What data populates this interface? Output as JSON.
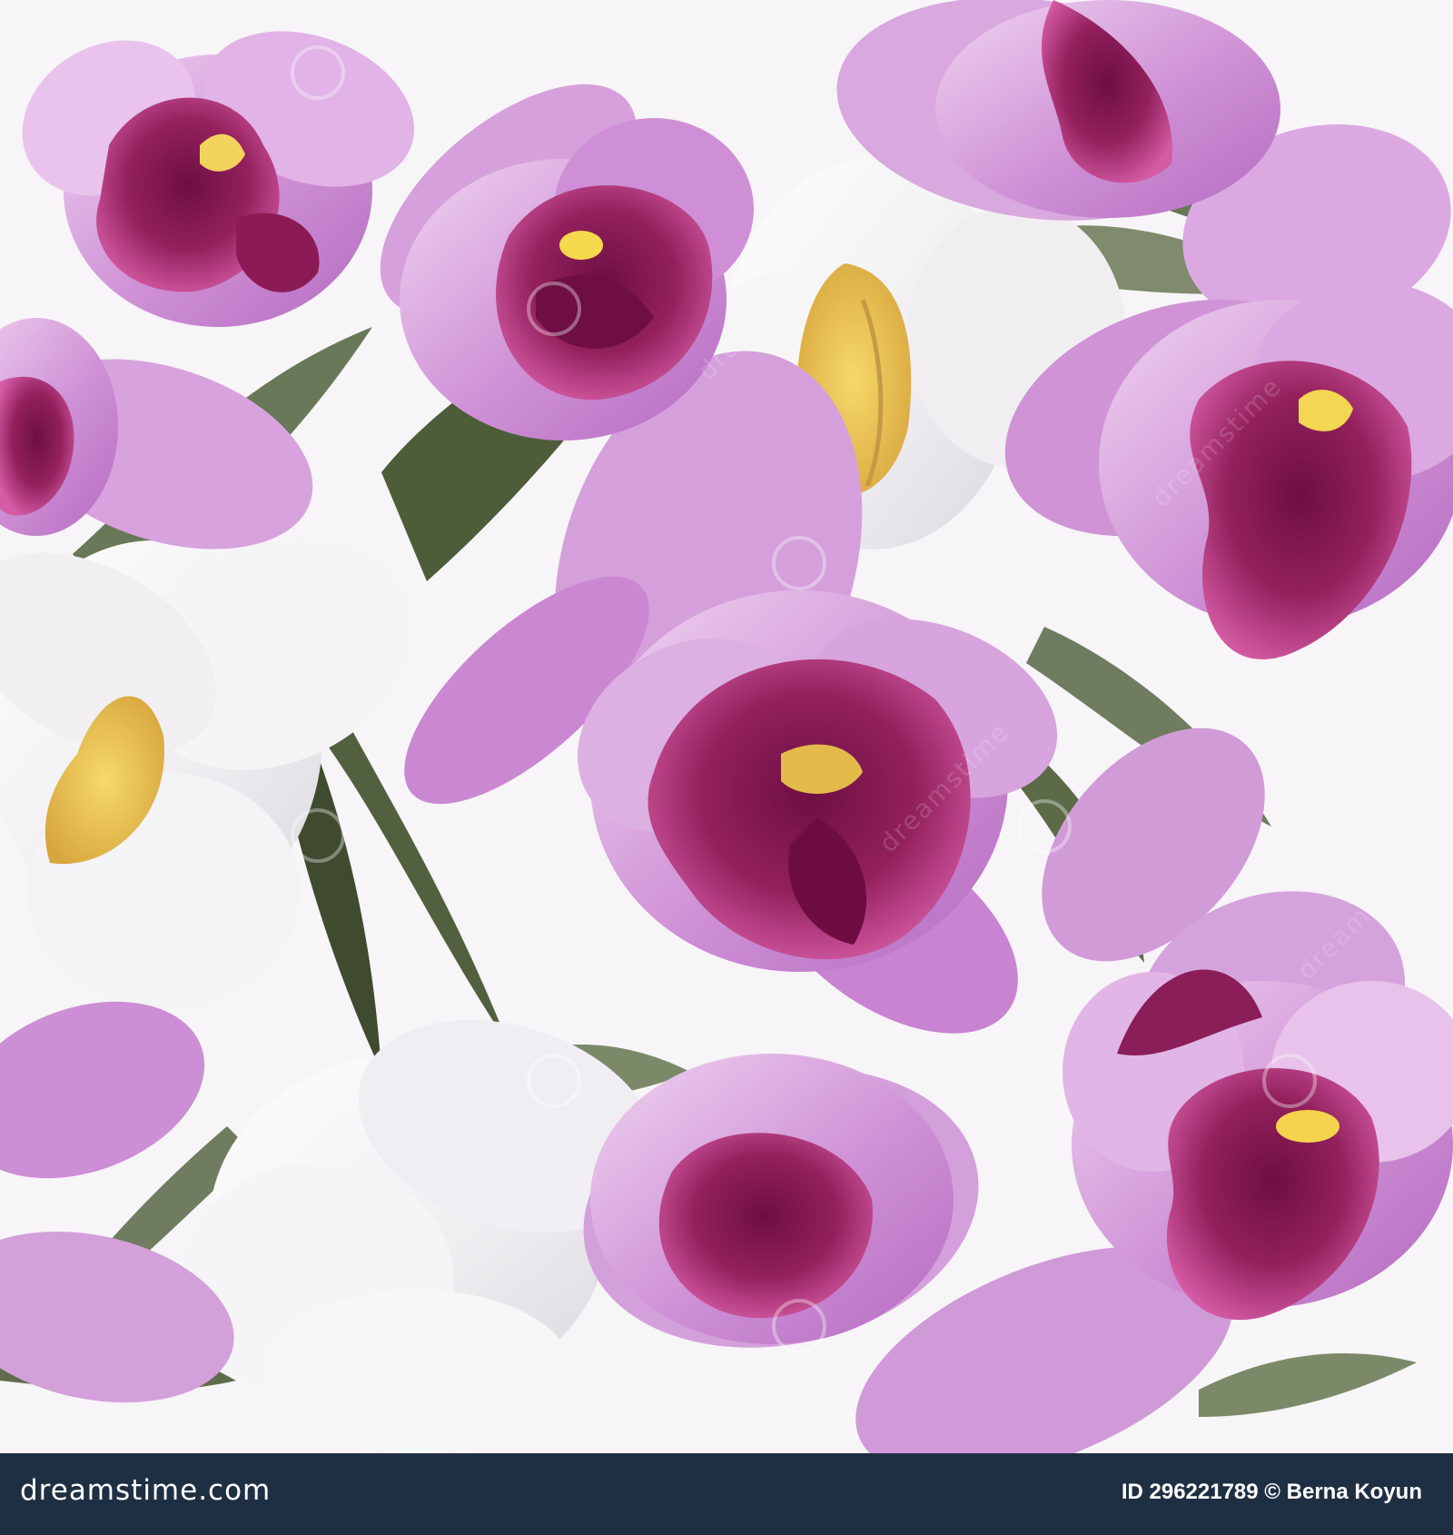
{
  "image": {
    "subject": "seamless orchid pattern",
    "palette": {
      "lilac": "#c98bd0",
      "light_lilac": "#e6c1e7",
      "magenta": "#8f1f5a",
      "white_petal": "#f3f0f2",
      "yellow": "#e4b84a",
      "leaf": "#6f7c60",
      "dark_leaf": "#3f4a2f",
      "footer": "#1f2f43"
    }
  },
  "watermark": {
    "brand": "dreamstime"
  },
  "footer": {
    "logo_text": "dreamstime.com",
    "credit_text": "ID 296221789 © Berna Koyun"
  }
}
